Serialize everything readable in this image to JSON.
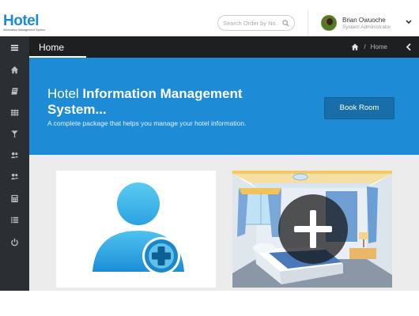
{
  "app": {
    "logo_title": "Hotel",
    "logo_subtitle": "Information Management System"
  },
  "header": {
    "search_placeholder": "Search Order by No.",
    "user_name": "Brian Owuoche",
    "user_role": "System Administrator"
  },
  "sidebar": {
    "items": [
      {
        "icon": "menu-icon"
      },
      {
        "icon": "home-icon"
      },
      {
        "icon": "book-icon"
      },
      {
        "icon": "grid-icon"
      },
      {
        "icon": "cocktail-icon"
      },
      {
        "icon": "users-icon"
      },
      {
        "icon": "users-icon"
      },
      {
        "icon": "calculator-icon"
      },
      {
        "icon": "list-icon"
      },
      {
        "icon": "power-icon"
      }
    ]
  },
  "breadcrumb": {
    "title": "Home",
    "separator": "/",
    "current": "Home"
  },
  "hero": {
    "title_light": "Hotel ",
    "title_bold": "Information Management System...",
    "subtitle": "A complete package that helps you manage your hotel information.",
    "button_label": "Book Room"
  },
  "cards": [
    {
      "icon": "add-user-icon"
    },
    {
      "icon": "add-room-icon"
    }
  ],
  "colors": {
    "brand": "#1e8bd0",
    "hero_bg": "#1e8bd6",
    "sidebar_bg": "#2a2f33",
    "crumb_bg": "#1d1f21",
    "button_bg": "#176ea8"
  }
}
